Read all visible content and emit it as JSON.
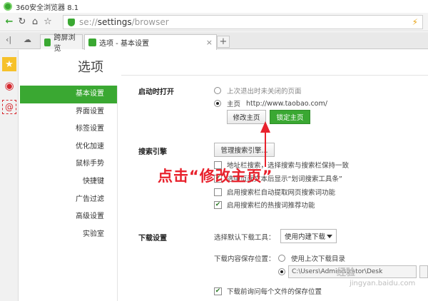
{
  "window": {
    "title": "360安全浏览器 8.1"
  },
  "address": {
    "scheme": "se://",
    "host": "settings",
    "path": "/browser"
  },
  "tabs": [
    {
      "label": "跨屏浏览",
      "color": "#3aa832"
    },
    {
      "label": "选项 - 基本设置",
      "color": "#3aa832"
    }
  ],
  "page": {
    "title": "选项"
  },
  "nav": {
    "items": [
      {
        "label": "基本设置",
        "active": true
      },
      {
        "label": "界面设置"
      },
      {
        "label": "标签设置"
      },
      {
        "label": "优化加速"
      },
      {
        "label": "鼠标手势"
      },
      {
        "label": "快捷键"
      },
      {
        "label": "广告过滤"
      },
      {
        "label": "高级设置"
      },
      {
        "label": "实验室"
      }
    ]
  },
  "startup": {
    "title": "启动时打开",
    "option_last": "上次退出时未关闭的页面",
    "option_home": "主页",
    "home_url": "http://www.taobao.com/",
    "modify_button": "修改主页",
    "lock_button": "锁定主页"
  },
  "search": {
    "title": "搜索引擎",
    "manage_button": "管理搜索引擎...",
    "opt1": "地址栏搜索，选择搜索与搜索栏保持一致",
    "opt2": "选中页面文本后显示“划词搜索工具条”",
    "opt3": "启用搜索栏自动提取网页搜索词功能",
    "opt4": "启用搜索栏的热搜词推荐功能"
  },
  "download": {
    "title": "下载设置",
    "tool_label": "选择默认下载工具：",
    "tool_value": "使用内建下载",
    "location_label": "下载内容保存位置：",
    "location_last": "使用上次下载目录",
    "path_value": "C:\\Users\\Administrator\\Desk",
    "ask_each": "下载前询问每个文件的保存位置"
  },
  "annotation": {
    "text": "点击“修改主页”",
    "color": "#e8212c"
  },
  "watermark": {
    "brand": "经验",
    "url": "jingyan.baidu.com"
  },
  "colors": {
    "accent": "#3aa832"
  }
}
